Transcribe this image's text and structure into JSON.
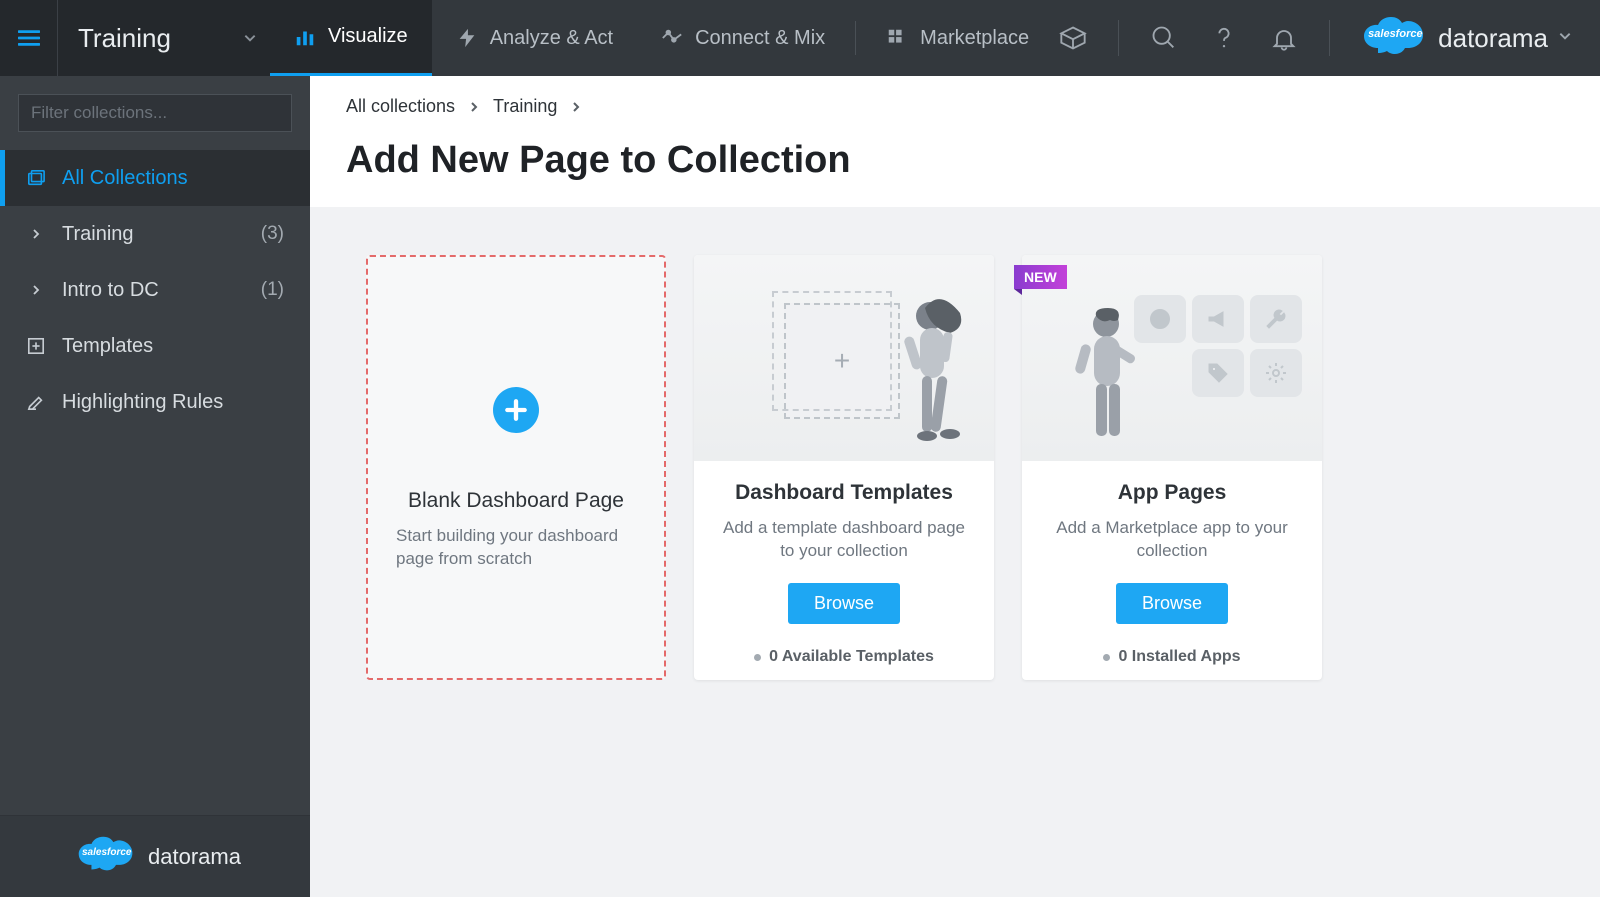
{
  "workspace": {
    "name": "Training"
  },
  "nav_tabs": [
    {
      "id": "visualize",
      "label": "Visualize",
      "icon": "bar-chart-icon",
      "active": true
    },
    {
      "id": "analyze",
      "label": "Analyze & Act",
      "icon": "bolt-icon"
    },
    {
      "id": "connect",
      "label": "Connect & Mix",
      "icon": "route-icon"
    },
    {
      "id": "marketplace",
      "label": "Marketplace",
      "icon": "grid-icon"
    }
  ],
  "brand": {
    "cloud_text": "salesforce",
    "name": "datorama"
  },
  "sidebar": {
    "filter_placeholder": "Filter collections...",
    "items": [
      {
        "icon": "collections-icon",
        "label": "All Collections",
        "active": true
      },
      {
        "icon": "chevron-right-icon",
        "label": "Training",
        "count": "(3)"
      },
      {
        "icon": "chevron-right-icon",
        "label": "Intro to DC",
        "count": "(1)"
      },
      {
        "icon": "plus-square-icon",
        "label": "Templates"
      },
      {
        "icon": "highlight-icon",
        "label": "Highlighting Rules"
      }
    ],
    "footer": {
      "cloud_text": "salesforce",
      "name": "datorama"
    }
  },
  "breadcrumb": [
    "All collections",
    "Training"
  ],
  "page_title": "Add New Page to Collection",
  "cards": {
    "blank": {
      "title": "Blank Dashboard Page",
      "desc": "Start building your dashboard page from scratch"
    },
    "templates": {
      "title": "Dashboard Templates",
      "desc": "Add a template dashboard page to your collection",
      "button": "Browse",
      "stat": "0 Available Templates"
    },
    "apps": {
      "badge": "NEW",
      "title": "App Pages",
      "desc": "Add a Marketplace app to your collection",
      "button": "Browse",
      "stat": "0 Installed Apps"
    }
  }
}
